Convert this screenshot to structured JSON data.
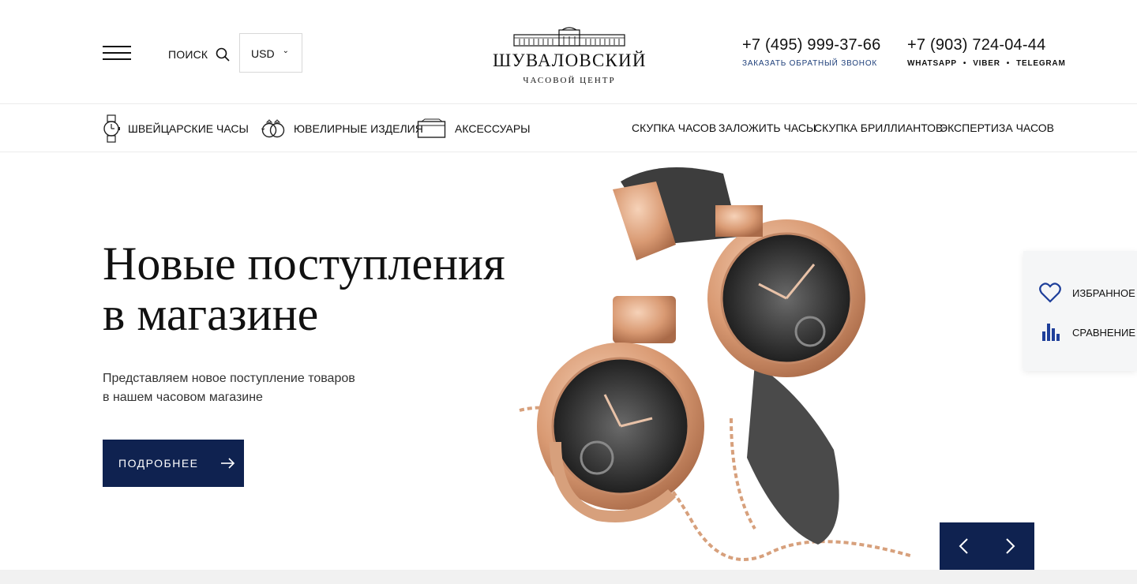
{
  "header": {
    "search_label": "ПОИСК",
    "currency": "USD",
    "logo": {
      "brand": "ШУВАЛОВСКИЙ",
      "subtitle": "ЧАСОВОЙ ЦЕНТР"
    },
    "phone1": {
      "number": "+7 (495) 999-37-66",
      "callback": "ЗАКАЗАТЬ ОБРАТНЫЙ ЗВОНОК"
    },
    "phone2": {
      "number": "+7 (903) 724-04-44",
      "messengers": [
        "WHATSAPP",
        "VIBER",
        "TELEGRAM"
      ],
      "separator": "•"
    }
  },
  "nav": {
    "left": [
      {
        "label": "ШВЕЙЦАРСКИЕ ЧАСЫ",
        "icon": "watch-icon"
      },
      {
        "label": "ЮВЕЛИРНЫЕ ИЗДЕЛИЯ",
        "icon": "rings-icon"
      },
      {
        "label": "АКСЕССУАРЫ",
        "icon": "wallet-icon"
      }
    ],
    "right": [
      "СКУПКА ЧАСОВ",
      "ЗАЛОЖИТЬ ЧАСЫ",
      "СКУПКА БРИЛЛИАНТОВ",
      "ЭКСПЕРТИЗА ЧАСОВ"
    ]
  },
  "hero": {
    "title_line1": "Новые поступления",
    "title_line2": "в магазине",
    "subtitle_line1": "Представляем новое поступление товаров",
    "subtitle_line2": "в нашем часовом магазине",
    "cta": "ПОДРОБНЕЕ"
  },
  "side_panel": {
    "favorites": "ИЗБРАННОЕ",
    "compare": "СРАВНЕНИЕ"
  },
  "colors": {
    "accent": "#0f2250",
    "link": "#1e3f7a",
    "gold": "#d9a07a"
  }
}
